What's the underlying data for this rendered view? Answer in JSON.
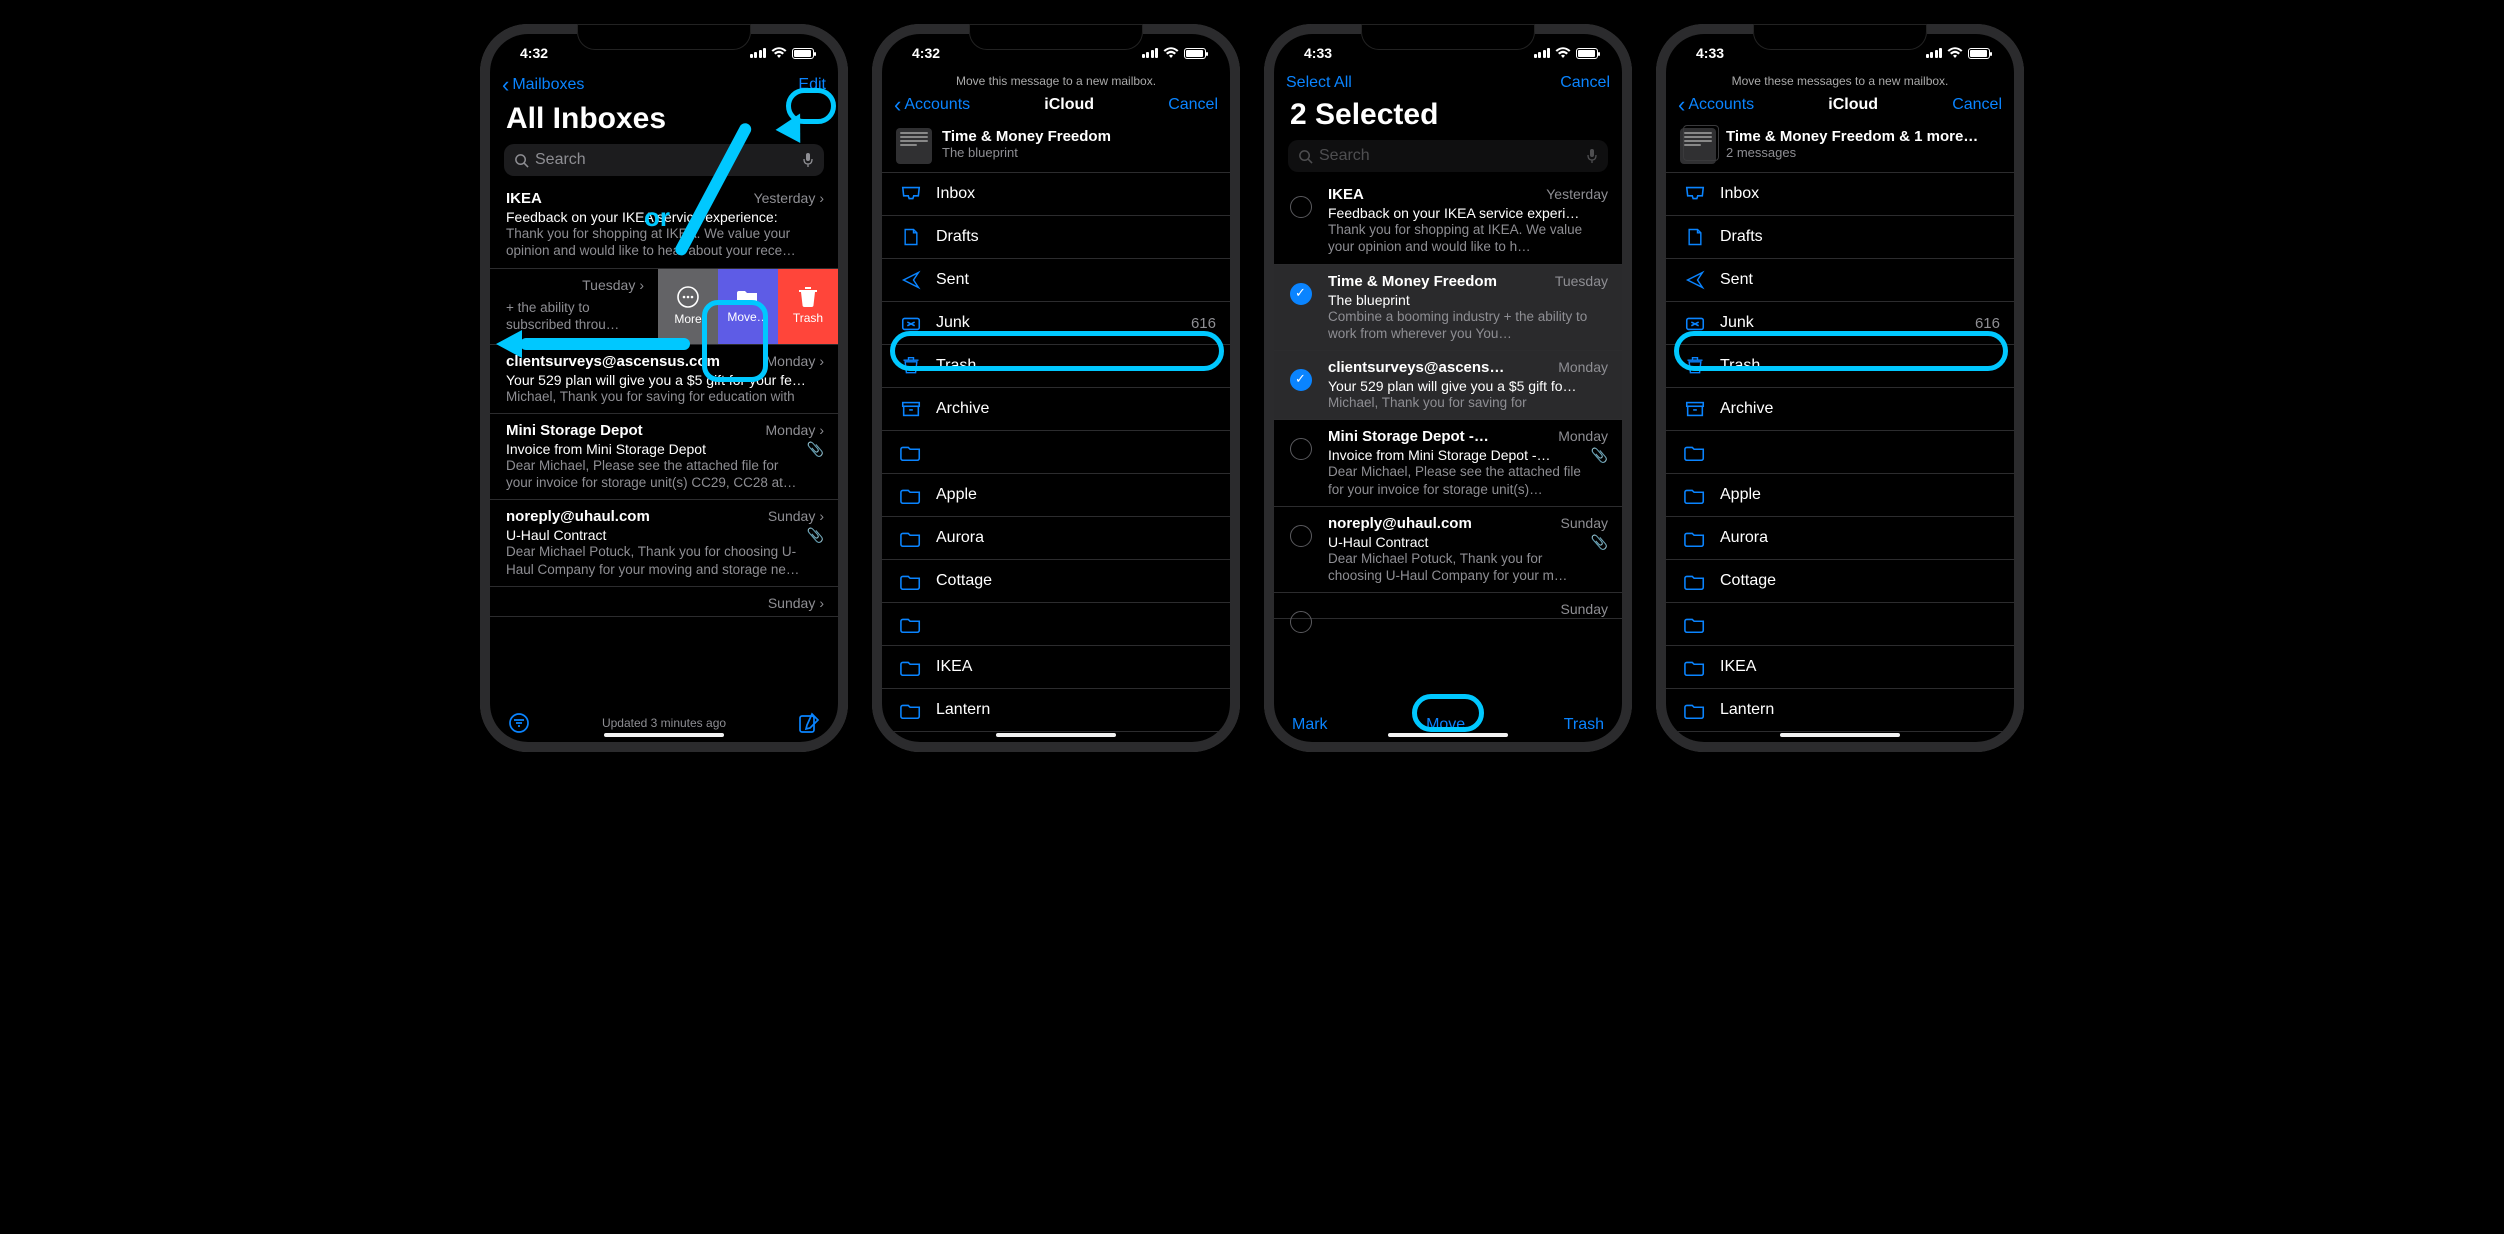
{
  "status": {
    "time1": "4:32",
    "time2": "4:32",
    "time3": "4:33",
    "time4": "4:33"
  },
  "s1": {
    "back": "Mailboxes",
    "edit": "Edit",
    "title": "All Inboxes",
    "or_label": "or",
    "search_placeholder": "Search",
    "updated": "Updated 3 minutes ago",
    "rows": [
      {
        "sender": "IKEA",
        "date": "Yesterday",
        "subject": "Feedback on your IKEA service experience:",
        "preview": "Thank you for shopping at IKEA. We value your opinion and would like to hear about your rece…"
      },
      {
        "sender": "",
        "date": "Tuesday",
        "subject": "",
        "preview": "+ the ability to subscribed throu…",
        "swipe": true
      },
      {
        "sender": "clientsurveys@ascensus.com",
        "date": "Monday",
        "subject": "Your 529 plan will give you a $5 gift for your fe…",
        "preview": "Michael, Thank you for saving for education with"
      },
      {
        "sender": "Mini Storage Depot",
        "date": "Monday",
        "subject": "Invoice from Mini Storage Depot",
        "preview": "Dear Michael, Please see the attached file for your invoice for storage unit(s) CC29, CC28 at…",
        "clip": true
      },
      {
        "sender": "noreply@uhaul.com",
        "date": "Sunday",
        "subject": "U-Haul Contract",
        "preview": "Dear Michael Potuck, Thank you for choosing U-Haul Company for your moving and storage ne…",
        "clip": true
      },
      {
        "sender": "",
        "date": "Sunday",
        "subject": "",
        "preview": ""
      }
    ],
    "swipe": {
      "more": "More",
      "move": "Move…",
      "trash": "Trash"
    }
  },
  "s2": {
    "hint": "Move this message to a new mailbox.",
    "back": "Accounts",
    "title": "iCloud",
    "cancel": "Cancel",
    "msg": {
      "title": "Time & Money Freedom",
      "sub": "The blueprint"
    },
    "junk_count": "616",
    "mailboxes": [
      "Inbox",
      "Drafts",
      "Sent",
      "Junk",
      "Trash",
      "Archive",
      "",
      "Apple",
      "Aurora",
      "Cottage",
      "",
      "IKEA",
      "Lantern",
      ""
    ]
  },
  "s3": {
    "select_all": "Select All",
    "cancel": "Cancel",
    "title": "2 Selected",
    "search_placeholder": "Search",
    "toolbar": {
      "mark": "Mark",
      "move": "Move",
      "trash": "Trash"
    },
    "rows": [
      {
        "sender": "IKEA",
        "date": "Yesterday",
        "subject": "Feedback on your IKEA service experi…",
        "preview": "Thank you for shopping at IKEA. We value your opinion and would like to h…",
        "sel": false
      },
      {
        "sender": "Time & Money Freedom",
        "date": "Tuesday",
        "subject": "The blueprint",
        "preview": "Combine a booming industry + the ability to work from wherever you You…",
        "sel": true
      },
      {
        "sender": "clientsurveys@ascens…",
        "date": "Monday",
        "subject": "Your 529 plan will give you a $5 gift fo…",
        "preview": "Michael, Thank you for saving for",
        "sel": true
      },
      {
        "sender": "Mini Storage Depot -…",
        "date": "Monday",
        "subject": "Invoice from Mini Storage Depot -…",
        "preview": "Dear Michael, Please see the attached file for your invoice for storage unit(s)…",
        "sel": false,
        "clip": true
      },
      {
        "sender": "noreply@uhaul.com",
        "date": "Sunday",
        "subject": "U-Haul Contract",
        "preview": "Dear Michael Potuck, Thank you for choosing U-Haul Company for your m…",
        "sel": false,
        "clip": true
      },
      {
        "sender": "",
        "date": "Sunday",
        "subject": "",
        "preview": "",
        "sel": false
      }
    ]
  },
  "s4": {
    "hint": "Move these messages to a new mailbox.",
    "back": "Accounts",
    "title": "iCloud",
    "cancel": "Cancel",
    "msg": {
      "title": "Time & Money Freedom & 1 more…",
      "sub": "2 messages"
    },
    "junk_count": "616",
    "mailboxes": [
      "Inbox",
      "Drafts",
      "Sent",
      "Junk",
      "Trash",
      "Archive",
      "",
      "Apple",
      "Aurora",
      "Cottage",
      "",
      "IKEA",
      "Lantern",
      ""
    ]
  }
}
